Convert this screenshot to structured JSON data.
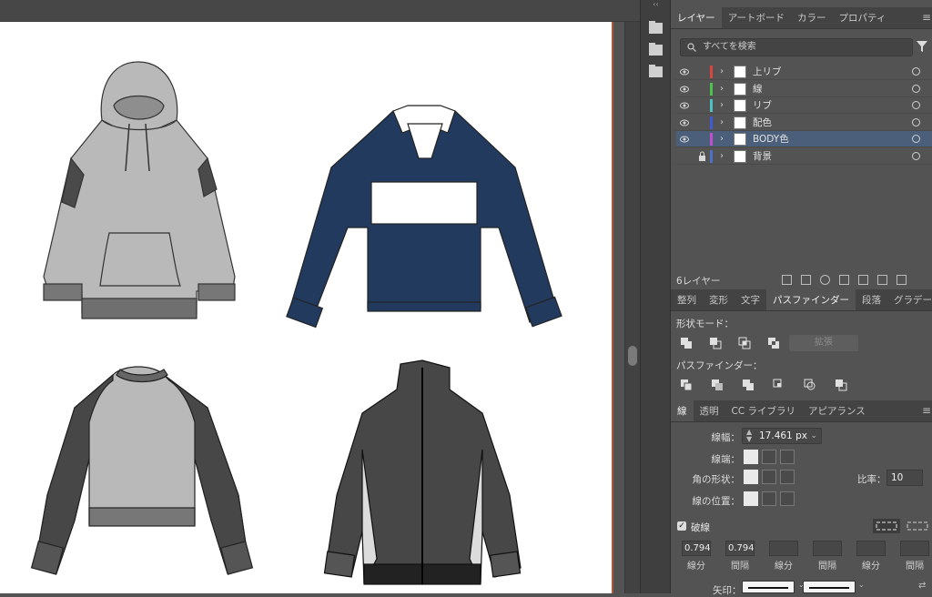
{
  "layers_panel": {
    "tabs": [
      "レイヤー",
      "アートボード",
      "カラー",
      "プロパティ"
    ],
    "search_placeholder": "すべてを検索",
    "layers": [
      {
        "name": "上リブ",
        "color": "#d8463e",
        "visible": true,
        "locked": false,
        "selected": false
      },
      {
        "name": "線",
        "color": "#4ec24e",
        "visible": true,
        "locked": false,
        "selected": false
      },
      {
        "name": "リブ",
        "color": "#4dc2c2",
        "visible": true,
        "locked": false,
        "selected": false
      },
      {
        "name": "配色",
        "color": "#3f5bd6",
        "visible": true,
        "locked": false,
        "selected": false
      },
      {
        "name": "BODY色",
        "color": "#c24ecb",
        "visible": true,
        "locked": false,
        "selected": true
      },
      {
        "name": "背景",
        "color": "#4a72c8",
        "visible": false,
        "locked": true,
        "selected": false
      }
    ],
    "layer_count": "6レイヤー"
  },
  "pathfinder_panel": {
    "tabs": [
      "整列",
      "変形",
      "文字",
      "パスファインダー",
      "段落",
      "グラデーシ"
    ],
    "shape_modes_label": "形状モード：",
    "expand_label": "拡張",
    "pathfinders_label": "パスファインダー："
  },
  "stroke_panel": {
    "tabs": [
      "線",
      "透明",
      "CC ライブラリ",
      "アピアランス"
    ],
    "weight_label": "線幅：",
    "weight_value": "17.461 px",
    "cap_label": "線端：",
    "corner_label": "角の形状：",
    "ratio_label": "比率：",
    "ratio_value": "10",
    "align_label": "線の位置：",
    "dashed_label": "破線",
    "dashed_checked": true,
    "dash_values": [
      "0.794",
      "0.794",
      "",
      "",
      "",
      ""
    ],
    "dash_captions": [
      "線分",
      "間隔",
      "線分",
      "間隔",
      "線分",
      "間隔"
    ],
    "arrow_label": "矢印："
  },
  "colors": {
    "navy": "#213a5e",
    "light_gray": "#b9b9b9",
    "dark_gray": "#474747",
    "selection": "#4b5f7a"
  }
}
